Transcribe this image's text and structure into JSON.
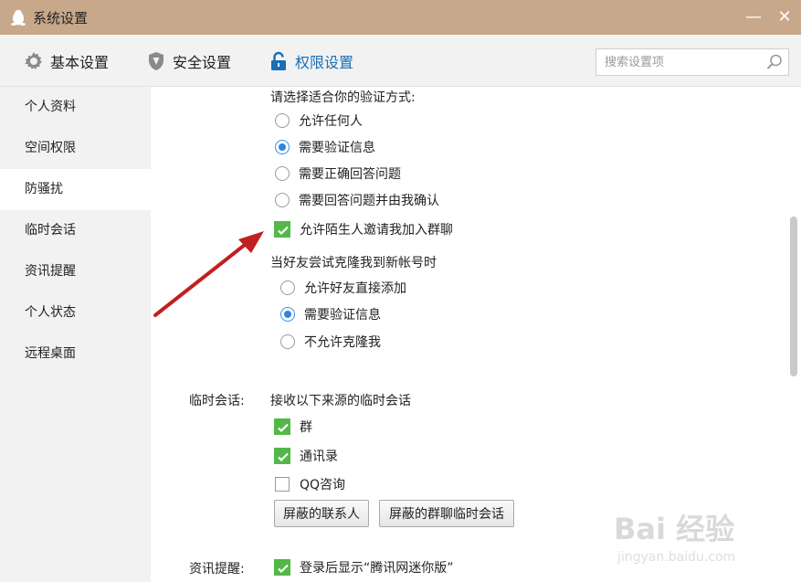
{
  "window": {
    "title": "系统设置",
    "minimize_glyph": "—",
    "close_glyph": "✕"
  },
  "toolbar": {
    "tabs": [
      {
        "label": "基本设置",
        "icon": "gear-icon",
        "active": false
      },
      {
        "label": "安全设置",
        "icon": "shield-icon",
        "active": false
      },
      {
        "label": "权限设置",
        "icon": "lock-icon",
        "active": true
      }
    ],
    "search_placeholder": "搜索设置项"
  },
  "sidebar": {
    "items": [
      {
        "label": "个人资料"
      },
      {
        "label": "空间权限"
      },
      {
        "label": "防骚扰",
        "active": true
      },
      {
        "label": "临时会话"
      },
      {
        "label": "资讯提醒"
      },
      {
        "label": "个人状态"
      },
      {
        "label": "远程桌面"
      }
    ]
  },
  "content": {
    "verify": {
      "heading": "请选择适合你的验证方式:",
      "options": [
        {
          "label": "允许任何人",
          "checked": false
        },
        {
          "label": "需要验证信息",
          "checked": true
        },
        {
          "label": "需要正确回答问题",
          "checked": false
        },
        {
          "label": "需要回答问题并由我确认",
          "checked": false
        }
      ]
    },
    "allow_invite": {
      "label": "允许陌生人邀请我加入群聊",
      "checked": true
    },
    "clone": {
      "heading": "当好友尝试克隆我到新帐号时",
      "options": [
        {
          "label": "允许好友直接添加",
          "checked": false
        },
        {
          "label": "需要验证信息",
          "checked": true
        },
        {
          "label": "不允许克隆我",
          "checked": false
        }
      ]
    },
    "temp_session": {
      "section_label": "临时会话:",
      "heading": "接收以下来源的临时会话",
      "options": [
        {
          "label": "群",
          "checked": true
        },
        {
          "label": "通讯录",
          "checked": true
        },
        {
          "label": "QQ咨询",
          "checked": false
        }
      ],
      "buttons": [
        "屏蔽的联系人",
        "屏蔽的群聊临时会话"
      ]
    },
    "news": {
      "section_label": "资讯提醒:",
      "option": {
        "label": "登录后显示“腾讯网迷你版”",
        "checked": true
      }
    }
  },
  "watermark": {
    "text": "Bai 经验",
    "sub": "jingyan.baidu.com"
  },
  "colors": {
    "titlebar": "#c8a88a",
    "accent_blue": "#1a6fb5",
    "check_green": "#53b848",
    "arrow_red": "#c0201f"
  }
}
